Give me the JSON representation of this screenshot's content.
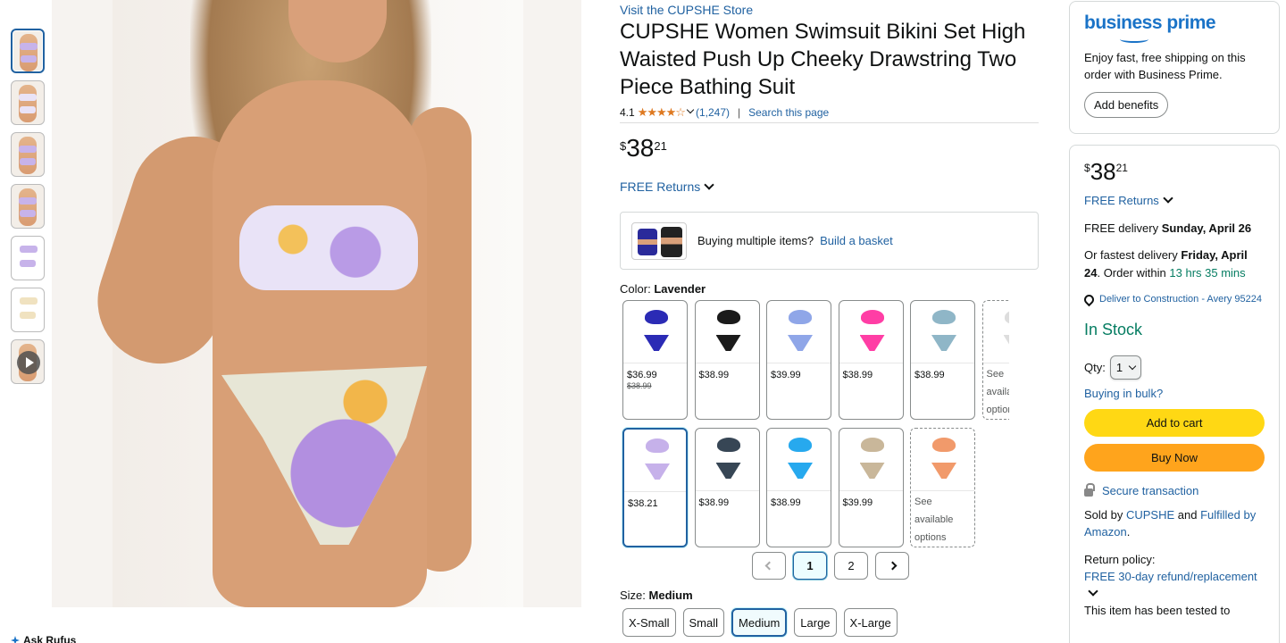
{
  "product": {
    "store_link": "Visit the CUPSHE Store",
    "title": "CUPSHE Women Swimsuit Bikini Set High Waisted Push Up Cheeky Drawstring Two Piece Bathing Suit",
    "rating": "4.1",
    "stars": "★★★★☆",
    "review_count": "(1,247)",
    "separator": "|",
    "search_page": "Search this page",
    "price": {
      "symbol": "$",
      "whole": "38",
      "fraction": "21"
    },
    "free_returns": "FREE Returns",
    "basket_prompt": "Buying multiple items?",
    "basket_link": "Build a basket",
    "color_label": "Color:",
    "color_value": "Lavender",
    "swatches": [
      {
        "price": "$36.99",
        "was": "$38.99",
        "top": "#2b2bb5",
        "bottom": "#2b2bb5"
      },
      {
        "price": "$38.99",
        "top": "#1b1b1b",
        "bottom": "#1b1b1b"
      },
      {
        "price": "$39.99",
        "top": "#8fa6e8",
        "bottom": "#8fa6e8"
      },
      {
        "price": "$38.99",
        "top": "#ff3ea5",
        "bottom": "#ff3ea5"
      },
      {
        "price": "$38.99",
        "top": "#8fb6c7",
        "bottom": "#8fb6c7"
      },
      {
        "see": "See available options",
        "top": "#dddddd",
        "bottom": "#dddddd"
      },
      {
        "price": "$38.21",
        "top": "#c6b1ea",
        "bottom": "#c6b1ea"
      },
      {
        "price": "$38.99",
        "top": "#374655",
        "bottom": "#374655"
      },
      {
        "price": "$38.99",
        "top": "#27a9ee",
        "bottom": "#27a9ee"
      },
      {
        "price": "$39.99",
        "top": "#c9b79a",
        "bottom": "#c9b79a"
      },
      {
        "see": "See available options",
        "top": "#f19a6b",
        "bottom": "#f19a6b"
      }
    ],
    "pager": {
      "pages": [
        "1",
        "2"
      ],
      "current": "1"
    },
    "size_label": "Size:",
    "size_value": "Medium",
    "sizes": [
      "X-Small",
      "Small",
      "Medium",
      "Large",
      "X-Large"
    ],
    "selected_size": "Medium"
  },
  "prime": {
    "logo": "business prime",
    "text": "Enjoy fast, free shipping on this order with Business Prime.",
    "button": "Add benefits"
  },
  "buybox": {
    "price": {
      "symbol": "$",
      "whole": "38",
      "fraction": "21"
    },
    "free_returns": "FREE Returns",
    "delivery_prefix": "FREE delivery ",
    "delivery_date": "Sunday, April 26",
    "fastest_prefix": "Or fastest delivery ",
    "fastest_date": "Friday, April 24",
    "order_within": ". Order within ",
    "countdown": "13 hrs 35 mins",
    "deliver_to": "Deliver to Construction - Avery 95224",
    "stock": "In Stock",
    "qty_label": "Qty:",
    "qty_value": "1",
    "bulk": "Buying in bulk?",
    "add_to_cart": "Add to cart",
    "buy_now": "Buy Now",
    "secure": "Secure transaction",
    "sold_prefix": "Sold by ",
    "seller": "CUPSHE",
    "and_text": " and ",
    "fulfilled": "Fulfilled by Amazon",
    "period": ".",
    "return_label": "Return policy:",
    "return_value": "FREE 30-day refund/replacement",
    "tested": "This item has been tested to"
  },
  "rufus": "Ask Rufus",
  "colors": {
    "link": "#2162a1",
    "cart": "#ffd814",
    "buy": "#ffa41c",
    "stock": "#067d62",
    "stars": "#de7921"
  }
}
